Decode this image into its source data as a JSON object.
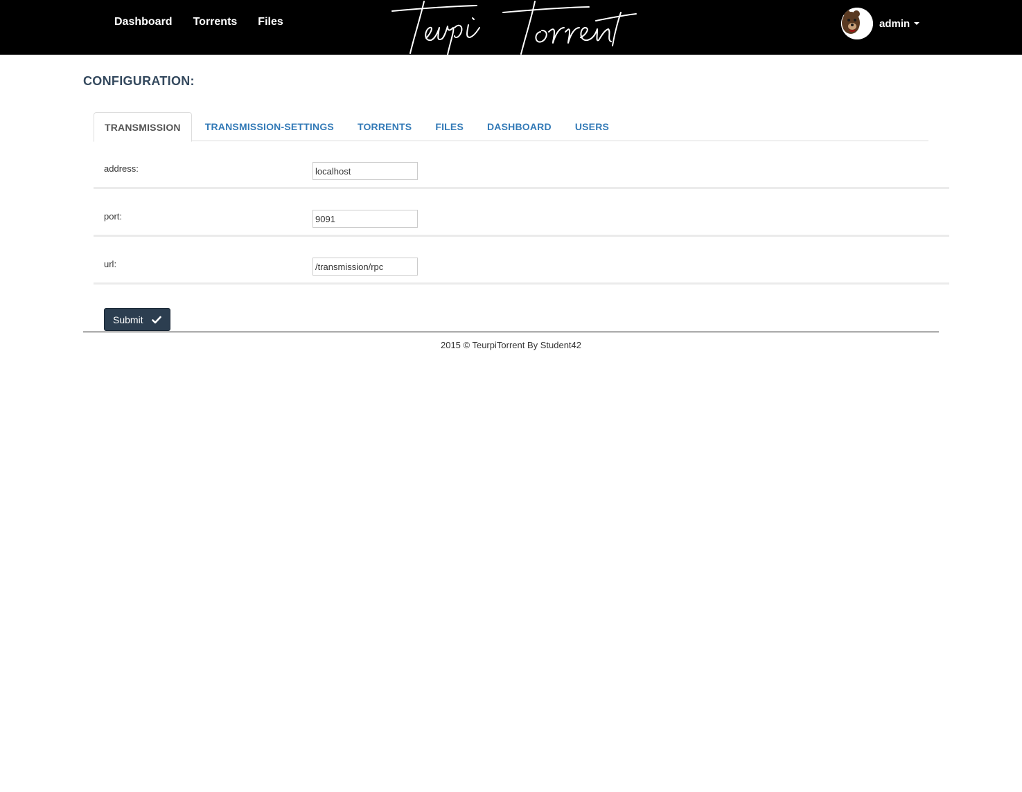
{
  "navbar": {
    "links": [
      "Dashboard",
      "Torrents",
      "Files"
    ],
    "logo_text": "Teurpi Torrent",
    "user": {
      "name": "admin"
    }
  },
  "page": {
    "title": "CONFIGURATION:"
  },
  "tabs": [
    {
      "label": "TRANSMISSION",
      "active": true
    },
    {
      "label": "TRANSMISSION-SETTINGS",
      "active": false
    },
    {
      "label": "TORRENTS",
      "active": false
    },
    {
      "label": "FILES",
      "active": false
    },
    {
      "label": "DASHBOARD",
      "active": false
    },
    {
      "label": "USERS",
      "active": false
    }
  ],
  "form": {
    "fields": [
      {
        "label": "address:",
        "value": "localhost"
      },
      {
        "label": "port:",
        "value": "9091"
      },
      {
        "label": "url:",
        "value": "/transmission/rpc"
      }
    ],
    "submit_label": "Submit"
  },
  "footer": {
    "text": "2015 © TeurpiTorrent By Student42"
  },
  "icons": {
    "submit": "check-icon",
    "user_menu": "caret-down-icon"
  },
  "colors": {
    "navbar_bg": "#000000",
    "tab_link": "#337ab7",
    "button_bg": "#2c3e50",
    "title": "#34495e"
  }
}
